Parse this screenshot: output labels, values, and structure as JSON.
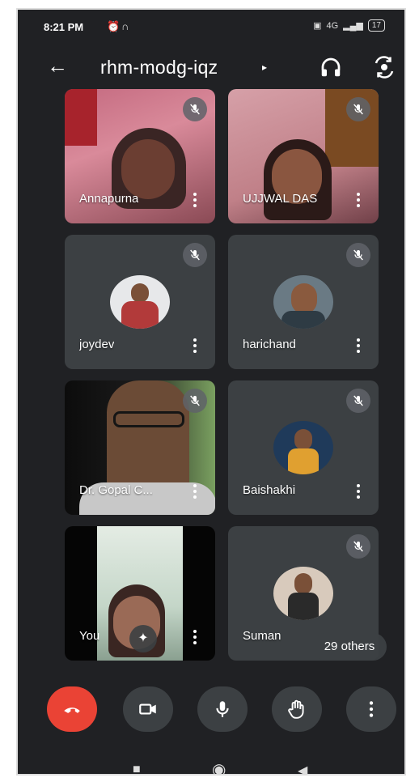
{
  "status_bar": {
    "time": "8:21 PM",
    "battery": "17",
    "network": "4G"
  },
  "header": {
    "meeting_code": "rhm-modg-iqz",
    "caret": "▸"
  },
  "participants": [
    {
      "name": "Annapurna",
      "muted": true
    },
    {
      "name": "UJJWAL DAS",
      "muted": true
    },
    {
      "name": "joydev",
      "muted": true
    },
    {
      "name": "harichand",
      "muted": true
    },
    {
      "name": "Dr. Gopal C...",
      "muted": true
    },
    {
      "name": "Baishakhi",
      "muted": true
    },
    {
      "name": "You",
      "muted": false
    },
    {
      "name": "Suman",
      "muted": true
    }
  ],
  "others_badge": "29 others",
  "controls": [
    "end-call",
    "camera",
    "microphone",
    "raise-hand",
    "more-options"
  ],
  "colors": {
    "background": "#202124",
    "tile": "#3c4043",
    "end_call": "#ea4335"
  }
}
